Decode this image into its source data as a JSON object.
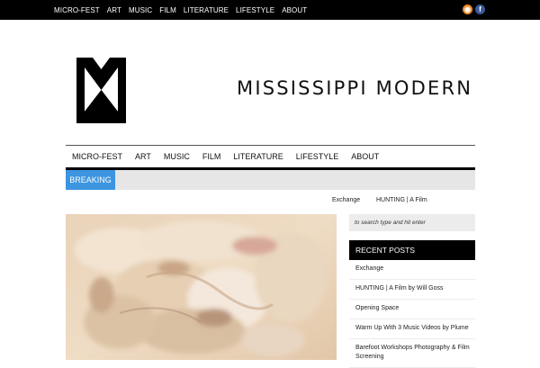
{
  "top_nav": {
    "items": [
      "MICRO-FEST",
      "ART",
      "MUSIC",
      "FILM",
      "LITERATURE",
      "LIFESTYLE",
      "ABOUT"
    ],
    "social": [
      {
        "icon": "rss-icon",
        "glyph": "◉",
        "color": "#f08a24"
      },
      {
        "icon": "facebook-icon",
        "glyph": "f",
        "color": "#3b5998"
      }
    ]
  },
  "header": {
    "site_name": "MISSISSIPPI MODERN"
  },
  "main_nav": {
    "items": [
      "MICRO-FEST",
      "ART",
      "MUSIC",
      "FILM",
      "LITERATURE",
      "LIFESTYLE",
      "ABOUT"
    ]
  },
  "breaking": {
    "label": "BREAKING",
    "accent": "#3d95e0"
  },
  "ticker": {
    "items": [
      "Exchange",
      "HUNTING | A Film"
    ]
  },
  "sidebar": {
    "search_placeholder": "to search type and hit enter",
    "recent_title": "RECENT POSTS",
    "recent_posts": [
      "Exchange",
      "HUNTING | A Film by Will Goss",
      "Opening Space",
      "Warm Up With 3 Music Videos by Plume",
      "Barefoot Workshops Photography & Film Screening"
    ]
  }
}
